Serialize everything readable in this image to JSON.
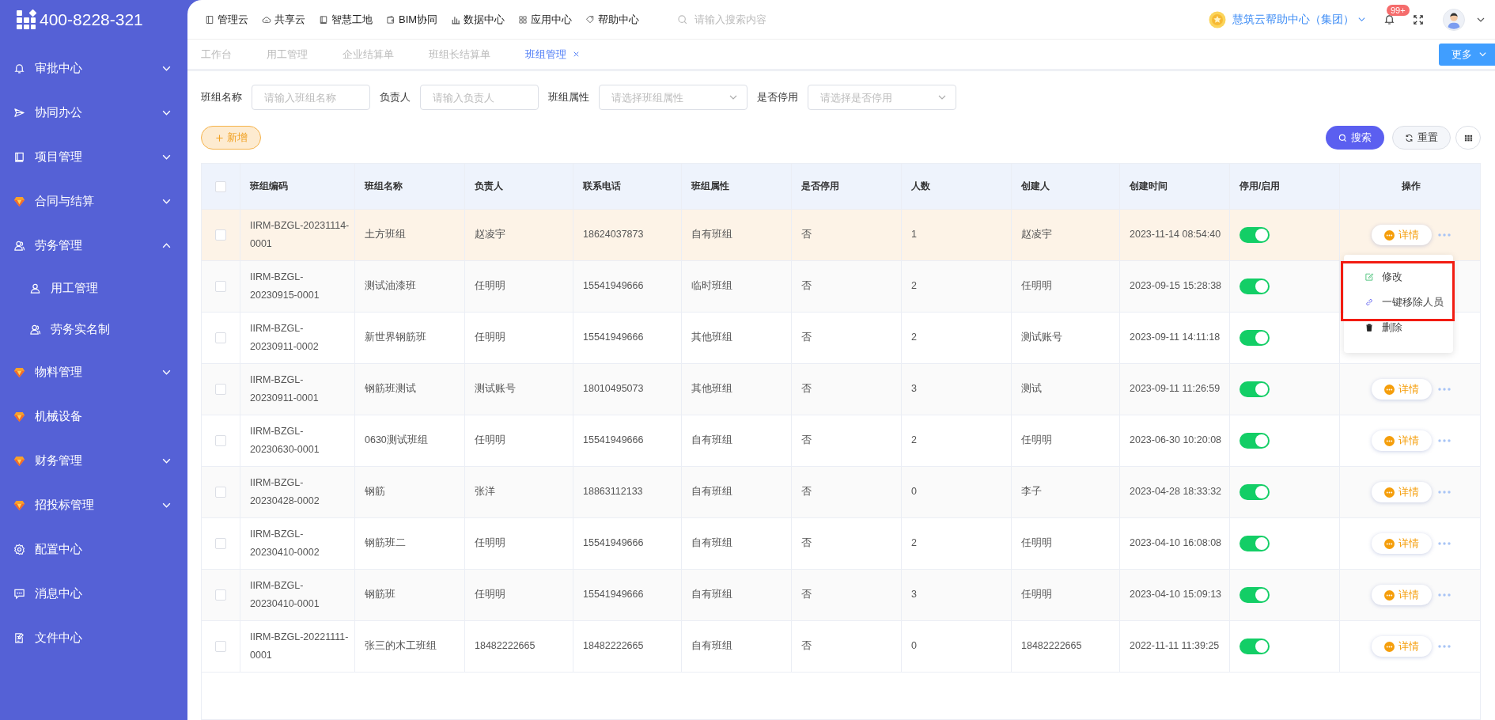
{
  "logo": {
    "text": "400-8228-321"
  },
  "sidebar": {
    "items": [
      {
        "label": "审批中心",
        "kind": "group",
        "expanded": false
      },
      {
        "label": "协同办公",
        "kind": "group",
        "expanded": false
      },
      {
        "label": "项目管理",
        "kind": "group",
        "expanded": false
      },
      {
        "label": "合同与结算",
        "kind": "group",
        "expanded": false
      },
      {
        "label": "劳务管理",
        "kind": "group",
        "expanded": true,
        "children": [
          {
            "label": "用工管理"
          },
          {
            "label": "劳务实名制"
          }
        ]
      },
      {
        "label": "物料管理",
        "kind": "group",
        "expanded": false
      },
      {
        "label": "机械设备",
        "kind": "link"
      },
      {
        "label": "财务管理",
        "kind": "group",
        "expanded": false
      },
      {
        "label": "招投标管理",
        "kind": "group",
        "expanded": false
      },
      {
        "label": "配置中心",
        "kind": "link"
      },
      {
        "label": "消息中心",
        "kind": "link"
      },
      {
        "label": "文件中心",
        "kind": "link"
      }
    ]
  },
  "top_nav": [
    "管理云",
    "共享云",
    "智慧工地",
    "BIM协同",
    "数据中心",
    "应用中心",
    "帮助中心"
  ],
  "search": {
    "placeholder": "请输入搜索内容"
  },
  "organization": "慧筑云帮助中心（集团）",
  "notifications": {
    "badge": "99+"
  },
  "tabs": [
    {
      "label": "工作台",
      "selected": false
    },
    {
      "label": "用工管理",
      "selected": false
    },
    {
      "label": "企业结算单",
      "selected": false
    },
    {
      "label": "班组长结算单",
      "selected": false
    },
    {
      "label": "班组管理",
      "selected": true
    }
  ],
  "more_button": "更多",
  "filters": [
    {
      "label": "班组名称",
      "kind": "input",
      "placeholder": "请输入班组名称"
    },
    {
      "label": "负责人",
      "kind": "input",
      "placeholder": "请输入负责人"
    },
    {
      "label": "班组属性",
      "kind": "select",
      "placeholder": "请选择班组属性"
    },
    {
      "label": "是否停用",
      "kind": "select",
      "placeholder": "请选择是否停用"
    }
  ],
  "buttons": {
    "add": "新增",
    "search": "搜索",
    "reset": "重置"
  },
  "table": {
    "all_checked": false,
    "columns": [
      "班组编码",
      "班组名称",
      "负责人",
      "联系电话",
      "班组属性",
      "是否停用",
      "人数",
      "创建人",
      "创建时间",
      "停用/启用",
      "操作"
    ],
    "rows": [
      {
        "checked": false,
        "highlighted": true,
        "cells": [
          "IIRM-BZGL-20231114-0001",
          "土方班组",
          "赵凌宇",
          "18624037873",
          "自有班组",
          "否",
          "1",
          "赵凌宇",
          "2023-11-14 08:54:40"
        ],
        "on": true,
        "action": "详情"
      },
      {
        "checked": false,
        "highlighted": false,
        "cells": [
          "IIRM-BZGL-20230915-0001",
          "测试油漆班",
          "任明明",
          "15541949666",
          "临时班组",
          "否",
          "2",
          "任明明",
          "2023-09-15 15:28:38"
        ],
        "on": true
      },
      {
        "checked": false,
        "highlighted": false,
        "cells": [
          "IIRM-BZGL-20230911-0002",
          "新世界钢筋班",
          "任明明",
          "15541949666",
          "其他班组",
          "否",
          "2",
          "测试账号",
          "2023-09-11 14:11:18"
        ],
        "on": true
      },
      {
        "checked": false,
        "highlighted": false,
        "cells": [
          "IIRM-BZGL-20230911-0001",
          "钢筋班测试",
          "测试账号",
          "18010495073",
          "其他班组",
          "否",
          "3",
          "测试",
          "2023-09-11 11:26:59"
        ],
        "on": true,
        "action": "详情"
      },
      {
        "checked": false,
        "highlighted": false,
        "cells": [
          "IIRM-BZGL-20230630-0001",
          "0630测试班组",
          "任明明",
          "15541949666",
          "自有班组",
          "否",
          "2",
          "任明明",
          "2023-06-30 10:20:08"
        ],
        "on": true,
        "action": "详情"
      },
      {
        "checked": false,
        "highlighted": false,
        "cells": [
          "IIRM-BZGL-20230428-0002",
          "钢筋",
          "张洋",
          "18863112133",
          "自有班组",
          "否",
          "0",
          "李子",
          "2023-04-28 18:33:32"
        ],
        "on": true,
        "action": "详情"
      },
      {
        "checked": false,
        "highlighted": false,
        "cells": [
          "IIRM-BZGL-20230410-0002",
          "钢筋班二",
          "任明明",
          "15541949666",
          "自有班组",
          "否",
          "2",
          "任明明",
          "2023-04-10 16:08:08"
        ],
        "on": true,
        "action": "详情"
      },
      {
        "checked": false,
        "highlighted": false,
        "cells": [
          "IIRM-BZGL-20230410-0001",
          "钢筋班",
          "任明明",
          "15541949666",
          "自有班组",
          "否",
          "3",
          "任明明",
          "2023-04-10 15:09:13"
        ],
        "on": true,
        "action": "详情"
      },
      {
        "checked": false,
        "highlighted": false,
        "cells": [
          "IIRM-BZGL-20221111-0001",
          "张三的木工班组",
          "18482222665",
          "18482222665",
          "自有班组",
          "否",
          "0",
          "18482222665",
          "2022-11-11 11:39:25"
        ],
        "on": true,
        "action": "详情"
      }
    ]
  },
  "row_menu": {
    "items": [
      "修改",
      "一键移除人员",
      "删除"
    ]
  }
}
